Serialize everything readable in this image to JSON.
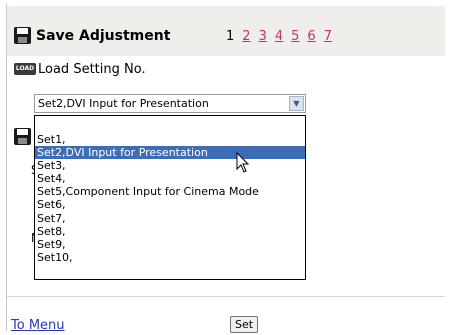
{
  "header": {
    "title": "Save Adjustment",
    "pages": [
      {
        "label": "1",
        "link": false
      },
      {
        "label": "2",
        "link": true
      },
      {
        "label": "3",
        "link": true
      },
      {
        "label": "4",
        "link": true
      },
      {
        "label": "5",
        "link": true
      },
      {
        "label": "6",
        "link": true
      },
      {
        "label": "7",
        "link": true
      }
    ]
  },
  "load": {
    "icon_text": "LOAD",
    "label": "Load Setting No.",
    "selected_value": "Set2,DVI Input for Presentation",
    "options": [
      "Set1,",
      "Set2,DVI Input for Presentation",
      "Set3,",
      "Set4,",
      "Set5,Component Input for Cinema Mode",
      "Set6,",
      "Set7,",
      "Set8,",
      "Set9,",
      "Set10,"
    ],
    "highlighted_index": 1
  },
  "partial_labels": {
    "s": "S",
    "n": "N"
  },
  "footer": {
    "menu_link": "To Menu",
    "set_button": "Set"
  },
  "colors": {
    "header_bg": "#efeeea",
    "page_link": "#c53070",
    "menu_link": "#2b38b0",
    "selection": "#3d6db6"
  }
}
